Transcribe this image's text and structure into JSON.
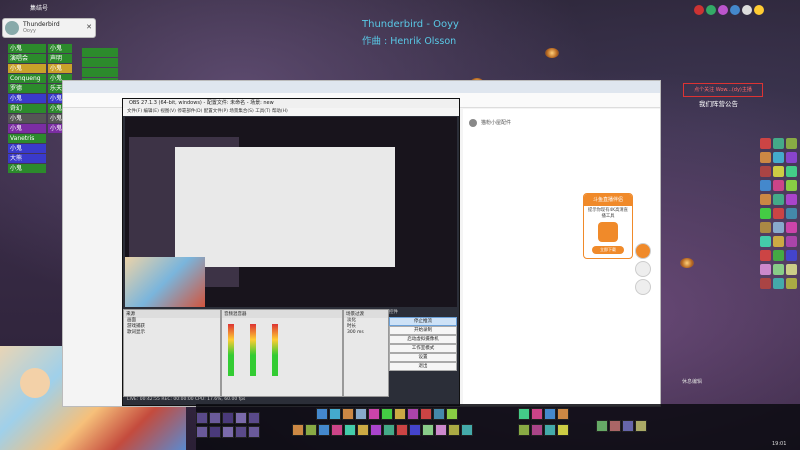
{
  "overlay": {
    "top_tag": "集结号",
    "viewer": {
      "name": "Thunderbird",
      "sub": "Ooyy",
      "close_label": "✕"
    },
    "song_title": "Thunderbird - Ooyy",
    "song_author": "作曲 : Henrik Olsson"
  },
  "raid_frames": [
    {
      "label": "小鬼",
      "color": "gr"
    },
    {
      "label": "演唱会",
      "color": "gr"
    },
    {
      "label": "小鬼",
      "color": "yl"
    },
    {
      "label": "Conqueng",
      "color": "gr"
    },
    {
      "label": "罗德",
      "color": "gr"
    },
    {
      "label": "小鬼",
      "color": "bl"
    },
    {
      "label": "奇幻",
      "color": "gr"
    },
    {
      "label": "小鬼",
      "color": "dk"
    },
    {
      "label": "小鬼",
      "color": "pu"
    },
    {
      "label": "Vanetris",
      "color": "gr"
    },
    {
      "label": "小鬼",
      "color": "bl"
    },
    {
      "label": "大熊",
      "color": "bl"
    },
    {
      "label": "小鬼",
      "color": "gr"
    }
  ],
  "raid_right_col": [
    "小鬼",
    "声明",
    "小鬼",
    "小鬼",
    "乐天",
    "小鬼",
    "小鬼",
    "小鬼",
    "小鬼"
  ],
  "obs": {
    "title": "OBS 27.1.3 (64-bit, windows) - 配置文件: 未命名 - 场景: new",
    "menu": "文件(F)  编辑(E)  视图(V)  停靠部件(D)  配置文件(P)  场景集合(S)  工具(T)  帮助(H)",
    "scenes_header": "来源",
    "sources": [
      "画面",
      "游戏捕获",
      "歌词显示"
    ],
    "mixer_header": "音频混音器",
    "transition_header": "场景过渡",
    "transition_value": "淡化",
    "duration_label": "时长",
    "duration_value": "300 ms",
    "controls_header": "控件",
    "controls": [
      {
        "label": "停止推流",
        "active": true
      },
      {
        "label": "开始录制",
        "active": false
      },
      {
        "label": "启动虚拟摄像机",
        "active": false
      },
      {
        "label": "工作室模式",
        "active": false
      },
      {
        "label": "设置",
        "active": false
      },
      {
        "label": "退出",
        "active": false
      }
    ],
    "status": "LIVE: 00:42:55   REC: 00:00:00   CPU: 17.6%, 60.00 fps"
  },
  "browser": {
    "panel_user": "猫粉小屋配件",
    "widget_title": "斗鱼直播伴侣",
    "widget_body": "提示你现有4K高清直播工具",
    "widget_button": "立即下载"
  },
  "right": {
    "red_notice": "点个关注 Wow...(dy)主播",
    "notice_title": "我们阵营公告",
    "chat_name": "休息编辑"
  },
  "clock": "19:01"
}
